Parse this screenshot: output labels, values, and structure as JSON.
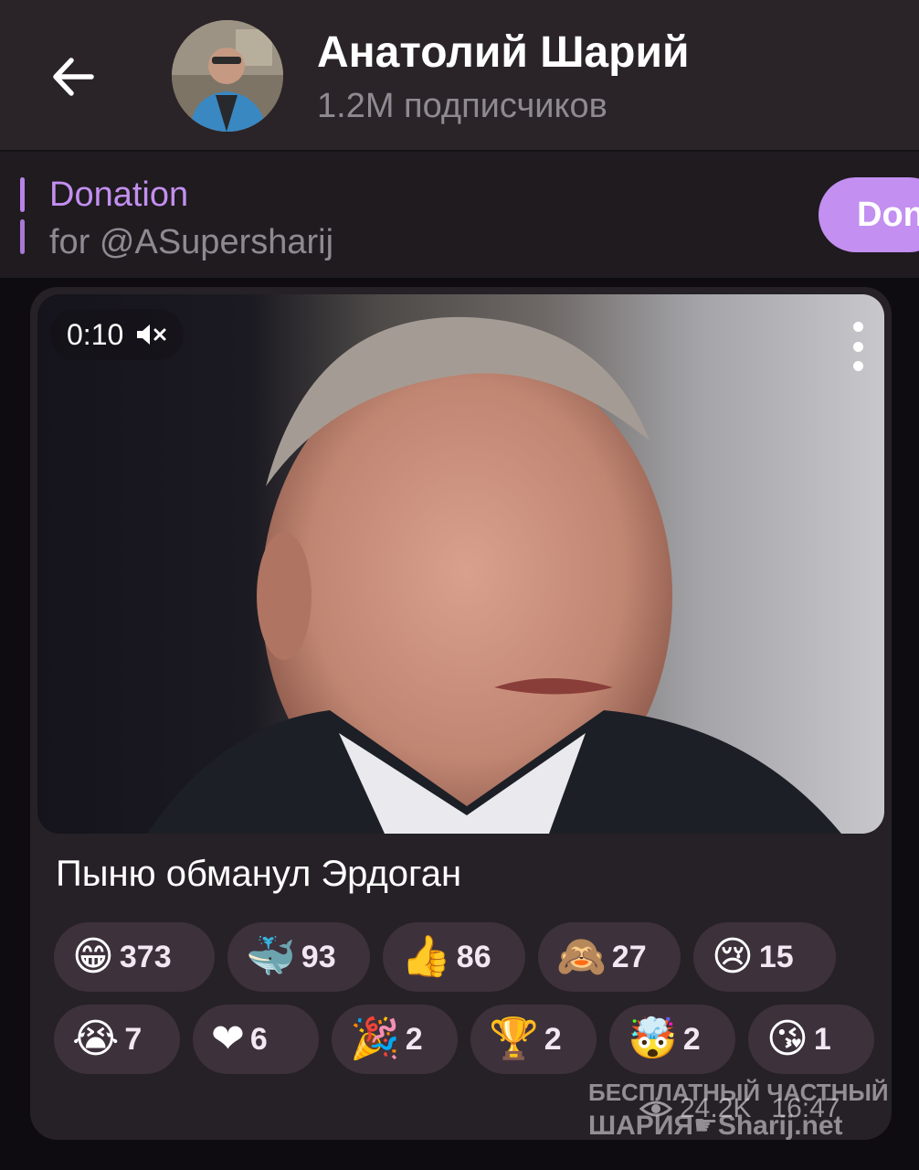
{
  "header": {
    "back_icon": "arrow-left-icon",
    "title": "Анатолий Шарий",
    "subtitle": "1.2M подписчиков"
  },
  "pinned": {
    "title": "Donation",
    "text": "for @ASupersharij",
    "button_label": "Don"
  },
  "message": {
    "video": {
      "duration": "0:10",
      "mute_icon": "speaker-muted-icon",
      "menu_icon": "kebab-menu-icon"
    },
    "caption": "Пыню обманул Эрдоган",
    "reactions_row1": [
      {
        "emoji": "😁",
        "count": "373"
      },
      {
        "emoji": "🐳",
        "count": "93"
      },
      {
        "emoji": "👍",
        "count": "86"
      },
      {
        "emoji": "🙈",
        "count": "27"
      },
      {
        "emoji": "😢",
        "count": "15"
      }
    ],
    "reactions_row2": [
      {
        "emoji": "😭",
        "count": "7"
      },
      {
        "emoji": "❤",
        "count": "6"
      },
      {
        "emoji": "🎉",
        "count": "2"
      },
      {
        "emoji": "🏆",
        "count": "2"
      },
      {
        "emoji": "🤯",
        "count": "2"
      },
      {
        "emoji": "😘",
        "count": "1"
      }
    ],
    "views": "24.2K",
    "time": "16:47"
  },
  "watermark": {
    "line1": "БЕСПЛАТНЫЙ ЧАСТНЫЙ",
    "line2": "ШАРИЯ☛Sharij.net"
  },
  "colors": {
    "header_bg": "#2a2428",
    "accent": "#c38ff0",
    "bubble_bg": "#262126",
    "reaction_bg": "#3d313c"
  }
}
